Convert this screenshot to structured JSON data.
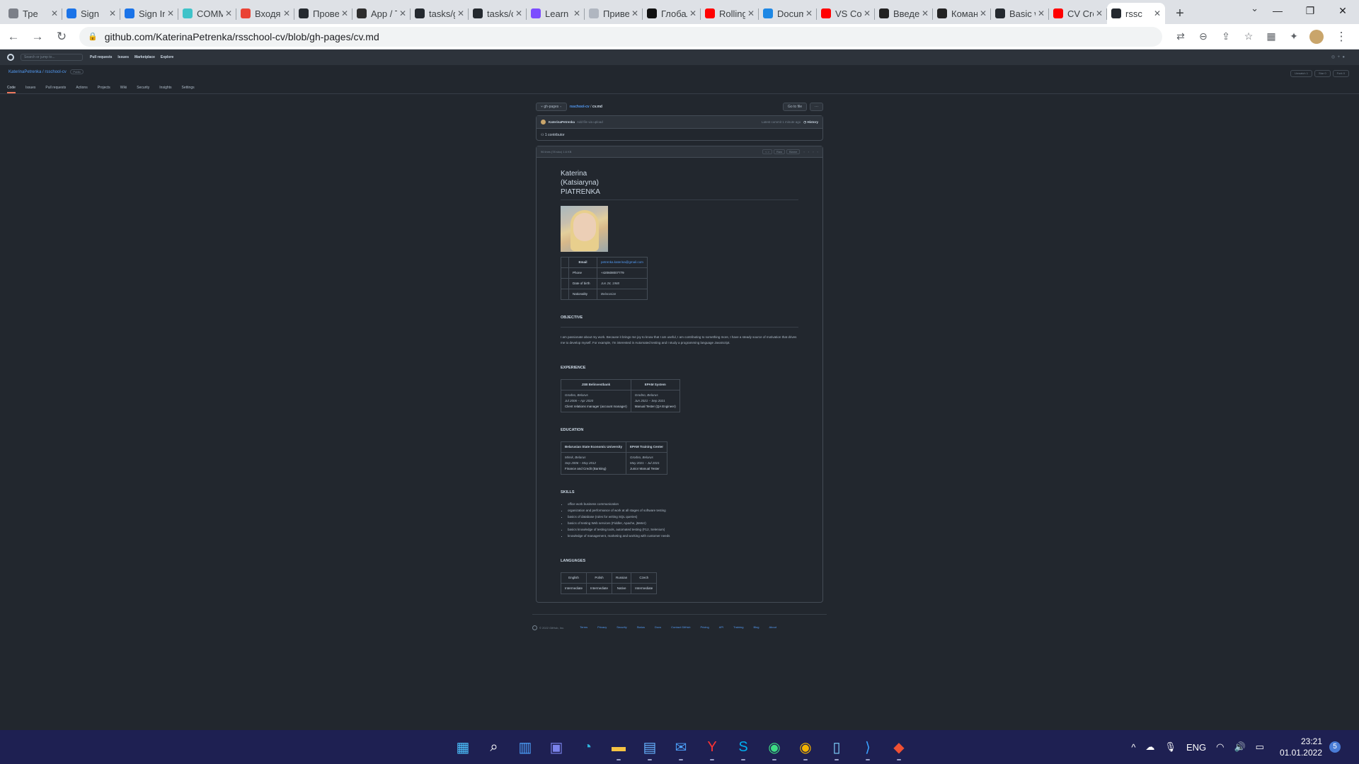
{
  "browser": {
    "tabs": [
      {
        "label": "Тре",
        "icon": "trello-icon",
        "color": "#7b7f88"
      },
      {
        "label": "Sign",
        "icon": "key-icon",
        "color": "#1a73e8"
      },
      {
        "label": "Sign In",
        "icon": "key-icon",
        "color": "#1a73e8"
      },
      {
        "label": "COMM",
        "icon": "zeplin-icon",
        "color": "#3fc3c9"
      },
      {
        "label": "Входящ",
        "icon": "gmail-icon",
        "color": "#ea4335"
      },
      {
        "label": "Провер",
        "icon": "github-icon",
        "color": "#24292f"
      },
      {
        "label": "App / T",
        "icon": "rs-icon",
        "color": "#2d2d2d"
      },
      {
        "label": "tasks/g",
        "icon": "github-icon",
        "color": "#24292f"
      },
      {
        "label": "tasks/c",
        "icon": "github-icon",
        "color": "#24292f"
      },
      {
        "label": "Learn G",
        "icon": "learn-icon",
        "color": "#7c4dff"
      },
      {
        "label": "Привет",
        "icon": "swirl-icon",
        "color": "#b0b6c0"
      },
      {
        "label": "Глобал",
        "icon": "bookmark-icon",
        "color": "#111111"
      },
      {
        "label": "Rolling",
        "icon": "youtube-icon",
        "color": "#ff0000"
      },
      {
        "label": "Docum",
        "icon": "vscode-icon",
        "color": "#1e88e5"
      },
      {
        "label": "VS Cod",
        "icon": "youtube-icon",
        "color": "#ff0000"
      },
      {
        "label": "Введен",
        "icon": "habr-icon",
        "color": "#222222"
      },
      {
        "label": "Команд",
        "icon": "habr-icon",
        "color": "#222222"
      },
      {
        "label": "Basic w",
        "icon": "github-icon",
        "color": "#24292f"
      },
      {
        "label": "CV Cro",
        "icon": "youtube-icon",
        "color": "#ff0000"
      },
      {
        "label": "rssc",
        "icon": "github-icon",
        "color": "#24292f"
      }
    ],
    "active_tab_index": 19,
    "url": "github.com/KaterinaPetrenka/rsschool-cv/blob/gh-pages/cv.md"
  },
  "github": {
    "search_placeholder": "Search or jump to...",
    "nav": [
      "Pull requests",
      "Issues",
      "Marketplace",
      "Explore"
    ],
    "repo": "KaterinaPetrenka / rsschool-cv",
    "visibility": "Public",
    "actions": [
      "Unwatch 1",
      "Star 0",
      "Fork 0"
    ],
    "tabs": [
      "Code",
      "Issues",
      "Pull requests",
      "Actions",
      "Projects",
      "Wiki",
      "Security",
      "Insights",
      "Settings"
    ],
    "branch": "gh-pages",
    "path_repo": "rsschool-cv",
    "path_file": "cv.md",
    "goto_file": "Go to file",
    "more": "···",
    "commit_author": "KaterinaPetrenka",
    "commit_msg": "Add file via upload",
    "commit_meta": "Latest commit 1 minute ago",
    "history": "History",
    "contributors": "1 contributor",
    "file_info": "96 lines (78 sloc)   1.6 KB",
    "file_buttons": [
      "< >",
      "Raw",
      "Blame"
    ]
  },
  "cv": {
    "name": "Katerina (Katsiaryna) PIATRENKA",
    "contacts": [
      {
        "label": "Email",
        "value": "petrenka.katerina@gmail.com"
      },
      {
        "label": "Phone",
        "value": "+420608007779"
      },
      {
        "label": "Date of birth",
        "value": "Jun 28, 1988"
      },
      {
        "label": "Nationality",
        "value": "Belarusian"
      }
    ],
    "objective_title": "OBJECTIVE",
    "objective_text": "I am passionate about my work. Because it brings me joy to know that I am useful, I am contributing to something more, I have a steady source of motivation that drives me to develop myself. For example, I'm interested in Automated testing and I study a programming language JavaScript.",
    "experience_title": "EXPERIENCE",
    "experience": [
      {
        "company": "JSB Belinvestbank",
        "place": "Grodno, Belarus",
        "dates": "Jul 2006 – Apr 2020",
        "role": "Client relations manager (account manager)"
      },
      {
        "company": "EPAM System",
        "place": "Grodno, Belarus",
        "dates": "Jun 2021 – Sep 2021",
        "role": "Manual Tester (QA Engineer)"
      }
    ],
    "education_title": "EDUCATION",
    "education": [
      {
        "school": "Belarusian State Economic University",
        "place": "Minsk, Belarus",
        "dates": "Sep 2006 – May 2012",
        "degree": "Finance and Credit (Banking)"
      },
      {
        "school": "EPAM Training Center",
        "place": "Grodno, Belarus",
        "dates": "May 2021 – Jul 2021",
        "degree": "Junior Manual Tester"
      }
    ],
    "skills_title": "SKILLS",
    "skills": [
      "office work business communication",
      "organization and performance of work at all stages of software testing",
      "basics of database (rules for writing SQL queries)",
      "basics of testing Web services (Fiddler, Apache, jMeter)",
      "basics knowledge of testing tools, automated testing (F12, Selenium)",
      "knowledge of management, marketing and working with customer needs"
    ],
    "languages_title": "LANGUAGES",
    "languages": [
      "English",
      "Polish",
      "Russian",
      "Czech"
    ],
    "levels": [
      "Intermediate",
      "Intermediate",
      "Native",
      "Intermediate"
    ]
  },
  "footer": {
    "copyright": "© 2022 GitHub, Inc.",
    "links": [
      "Terms",
      "Privacy",
      "Security",
      "Status",
      "Docs",
      "Contact GitHub",
      "Pricing",
      "API",
      "Training",
      "Blog",
      "About"
    ]
  },
  "taskbar": {
    "apps": [
      "windows-start-icon",
      "search-icon",
      "widgets-icon",
      "teams-icon",
      "edge-icon",
      "file-explorer-icon",
      "store-icon",
      "mail-icon",
      "yandex-icon",
      "skype-icon",
      "chrome-icon",
      "chrome-profile-icon",
      "notepad-icon",
      "vscode-icon",
      "git-icon"
    ],
    "lang": "ENG",
    "time": "23:21",
    "date": "01.01.2022",
    "notifications": "5"
  }
}
